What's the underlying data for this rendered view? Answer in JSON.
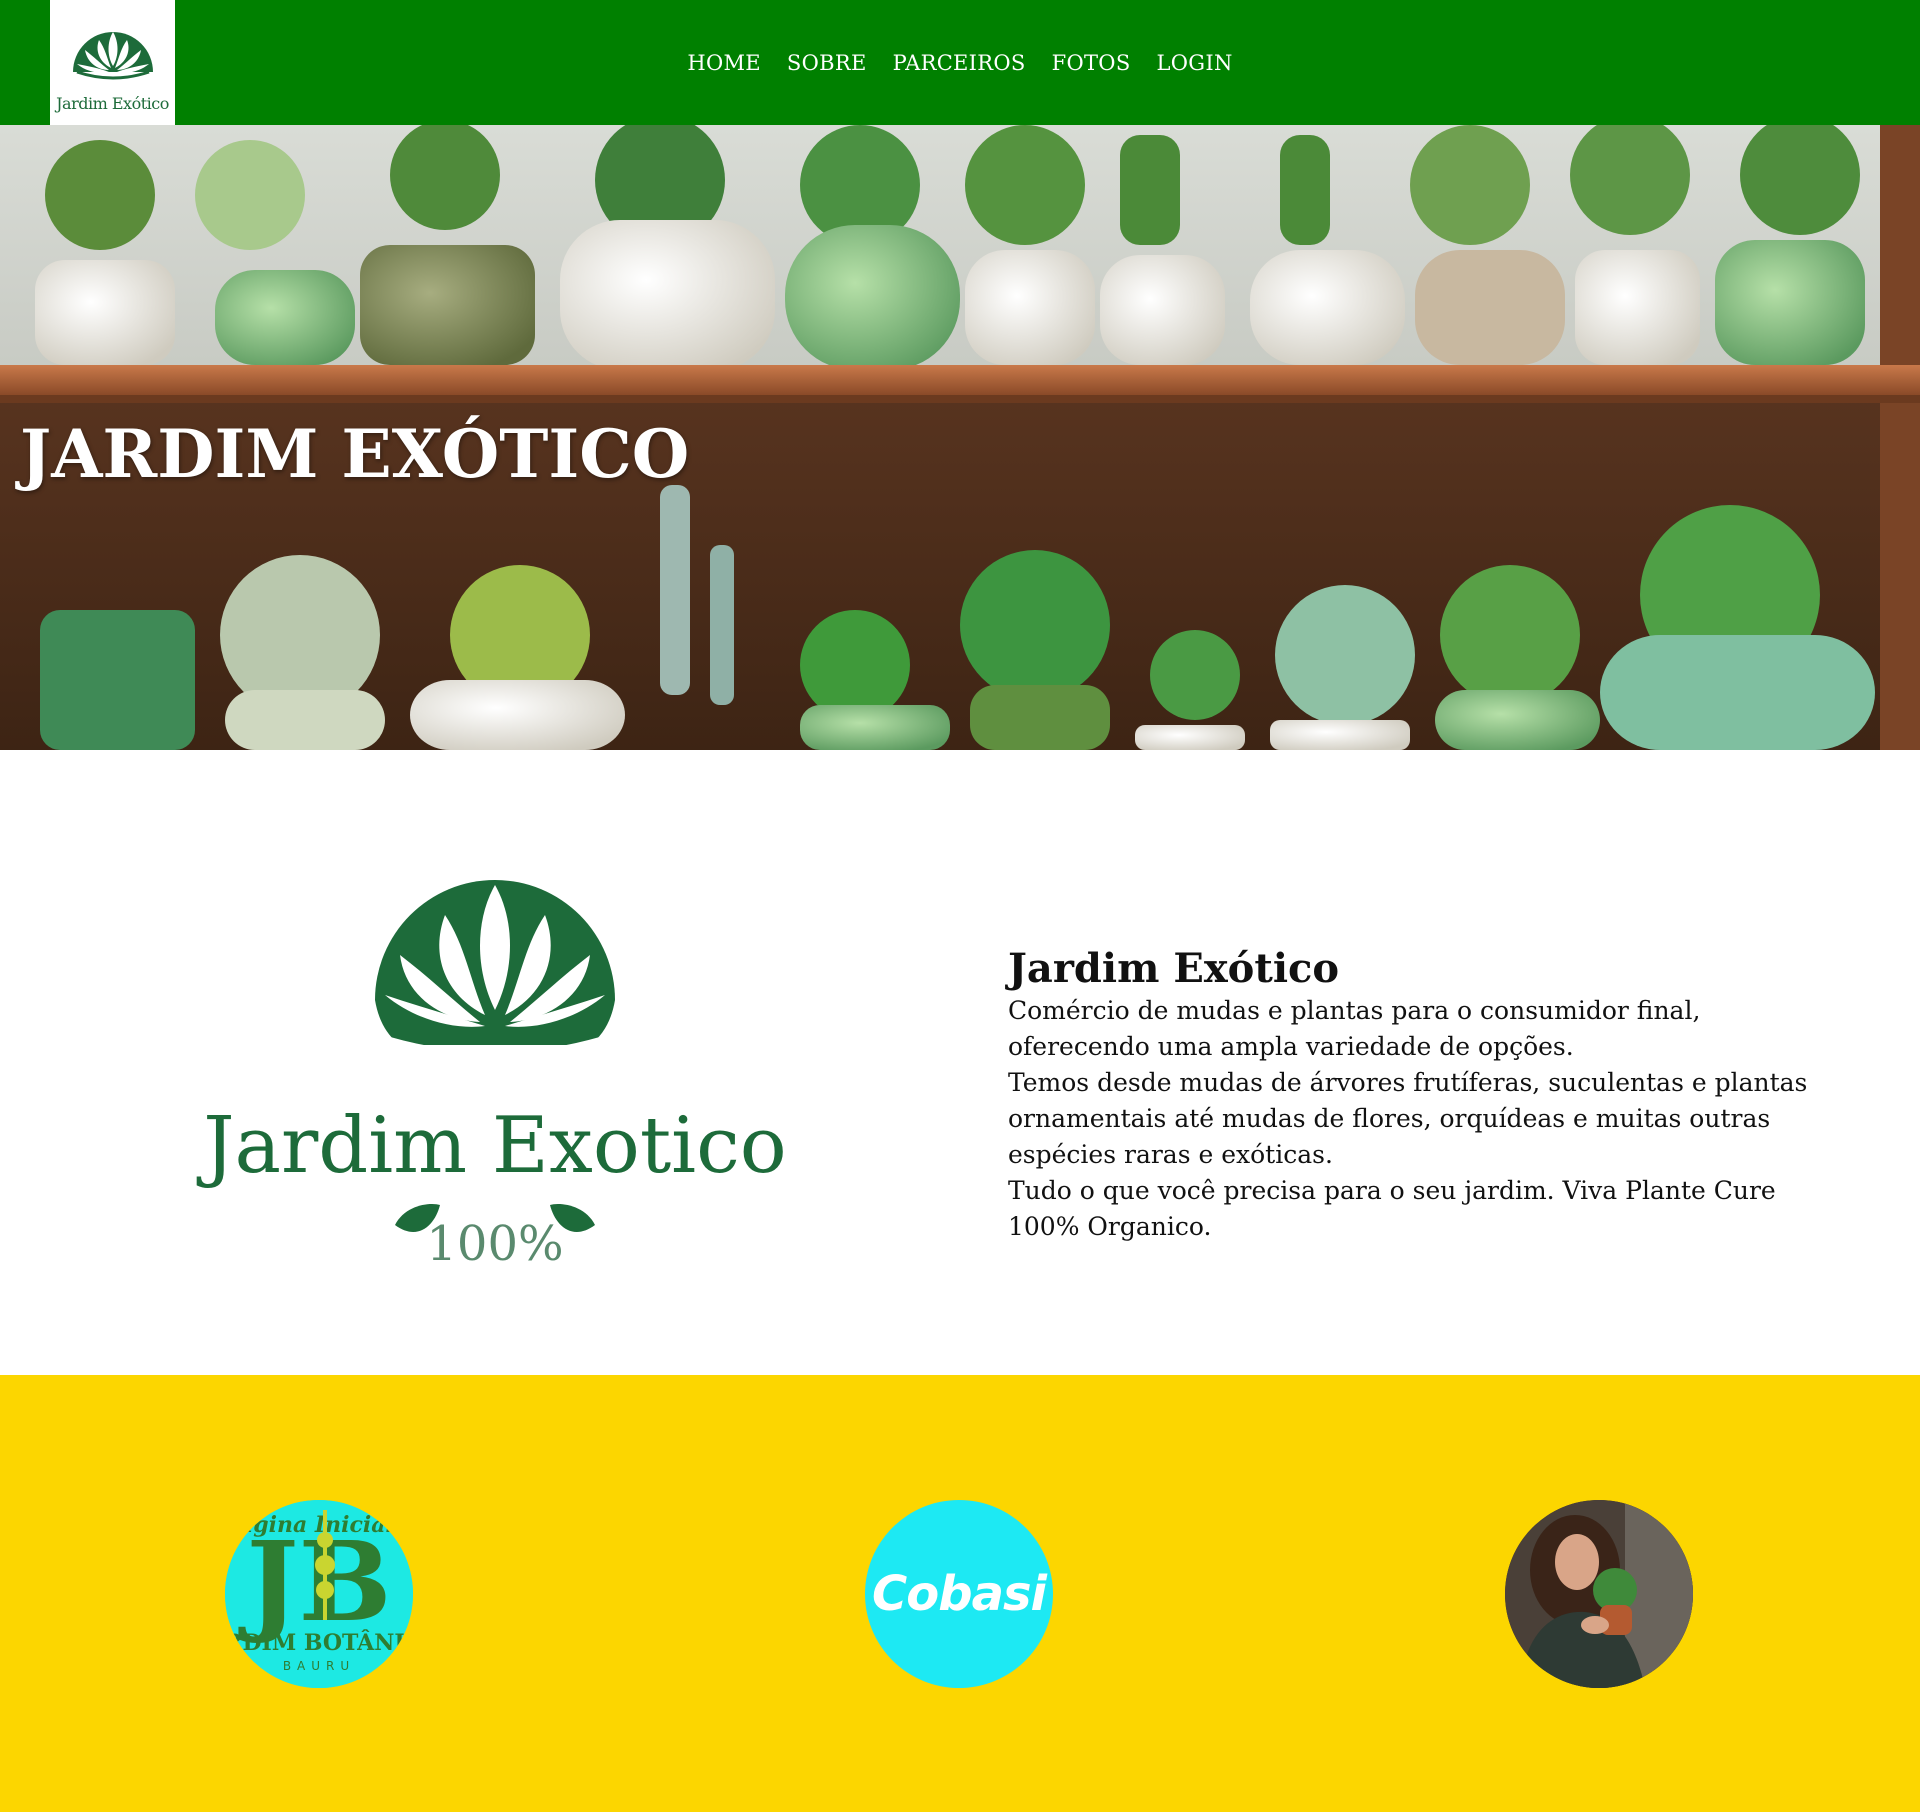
{
  "brand": {
    "name": "Jardim Exótico",
    "logo_caption_nav": "Jardim Exótico",
    "logo_caption_large": "Jardim Exotico",
    "logo_badge": "100%",
    "green": "#008000",
    "logo_green": "#1d6b3a"
  },
  "nav": {
    "items": [
      {
        "label": "HOME"
      },
      {
        "label": "SOBRE"
      },
      {
        "label": "PARCEIROS"
      },
      {
        "label": "FOTOS"
      },
      {
        "label": "LOGIN"
      }
    ]
  },
  "hero": {
    "title": "JARDIM EXÓTICO",
    "image": "succulent-shelf-photo"
  },
  "about": {
    "title": "Jardim Exótico",
    "paragraphs": [
      "Comércio de mudas e plantas para o consumidor final, oferecendo uma ampla variedade de opções.",
      "Temos desde mudas de árvores frutíferas, suculentas e plantas ornamentais até mudas de flores, orquídeas e muitas outras espécies raras e exóticas.",
      "Tudo o que você precisa para o seu jardim. Viva Plante Cure 100% Organico."
    ]
  },
  "partners": {
    "background": "#fcd600",
    "items": [
      {
        "name": "jardim-botanico-bauru",
        "text_main": "JARDIM BOTÂNICO",
        "text_sub": "BAURU",
        "text_side": "Página Inicial",
        "monogram": "JB"
      },
      {
        "name": "cobasi",
        "text_main": "Cobasi"
      },
      {
        "name": "plant-shop-woman-photo"
      }
    ]
  }
}
